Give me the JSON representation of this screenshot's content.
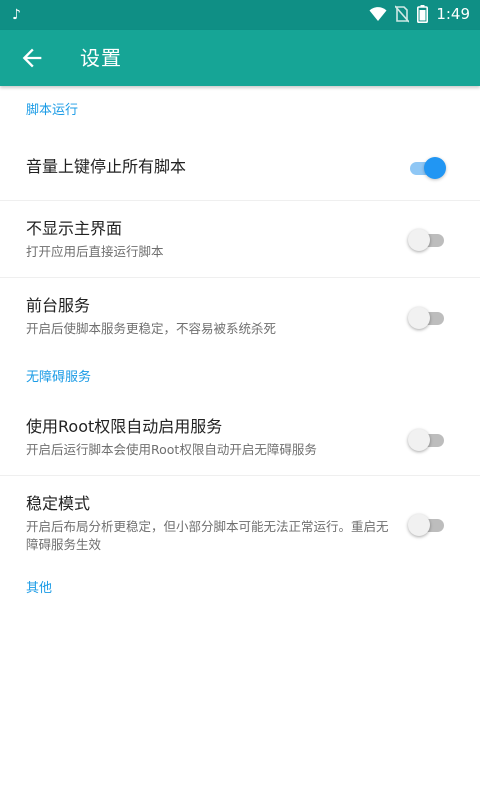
{
  "status_bar": {
    "left_icon": "tiktok-icon",
    "time": "1:49",
    "icons": [
      "wifi-icon",
      "no-sim-icon",
      "battery-icon"
    ]
  },
  "app_bar": {
    "back_icon": "arrow-left-icon",
    "title": "设置"
  },
  "sections": [
    {
      "header": "脚本运行",
      "items": [
        {
          "title": "音量上键停止所有脚本",
          "summary": "",
          "enabled": true
        },
        {
          "title": "不显示主界面",
          "summary": "打开应用后直接运行脚本",
          "enabled": false
        },
        {
          "title": "前台服务",
          "summary": "开启后使脚本服务更稳定，不容易被系统杀死",
          "enabled": false
        }
      ]
    },
    {
      "header": "无障碍服务",
      "items": [
        {
          "title": "使用Root权限自动启用服务",
          "summary": "开启后运行脚本会使用Root权限自动开启无障碍服务",
          "enabled": false
        },
        {
          "title": "稳定模式",
          "summary": "开启后布局分析更稳定，但小部分脚本可能无法正常运行。重启无障碍服务生效",
          "enabled": false
        }
      ]
    },
    {
      "header": "其他",
      "items": []
    }
  ],
  "colors": {
    "status_bar": "#0f8f85",
    "app_bar": "#16a596",
    "accent": "#1a9be6",
    "switch_on": "#2196f3"
  }
}
